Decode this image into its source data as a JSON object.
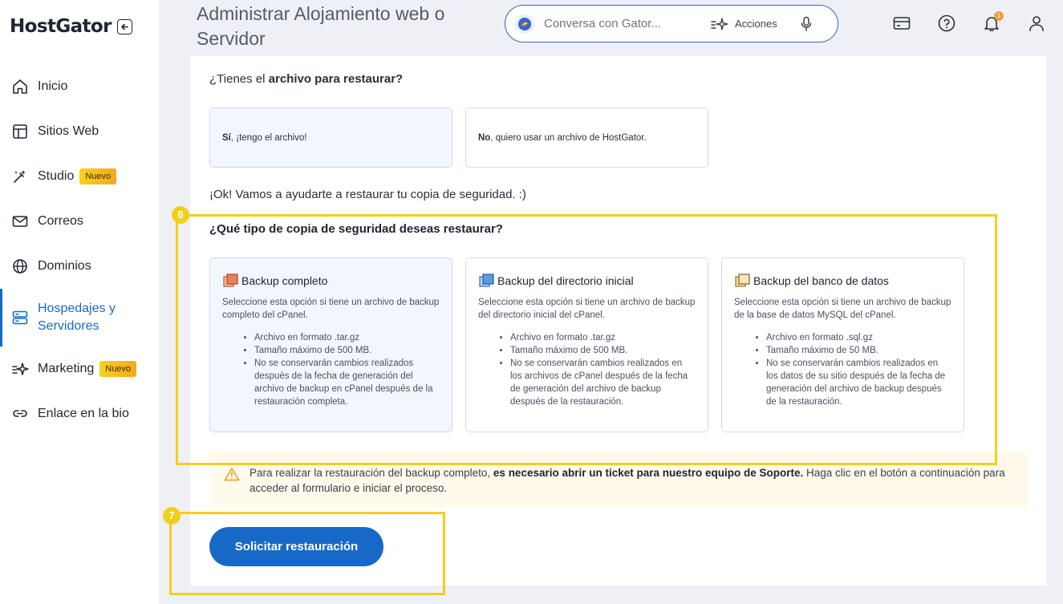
{
  "sidebar": {
    "logo": "HostGator",
    "items": [
      {
        "label": "Inicio",
        "icon": "home-icon"
      },
      {
        "label": "Sitios Web",
        "icon": "layout-icon"
      },
      {
        "label": "Studio",
        "icon": "magic-wand-icon",
        "badge": "Nuevo"
      },
      {
        "label": "Correos",
        "icon": "mail-icon"
      },
      {
        "label": "Dominios",
        "icon": "globe-icon"
      },
      {
        "label": "Hospedajes y Servidores",
        "icon": "server-icon",
        "active": true
      },
      {
        "label": "Marketing",
        "icon": "sparkle-icon",
        "badge": "Nuevo"
      },
      {
        "label": "Enlace en la bio",
        "icon": "link-icon"
      }
    ]
  },
  "header": {
    "title": "Administrar Alojamiento web o Servidor",
    "search_placeholder": "Conversa con Gator...",
    "actions_label": "Acciones",
    "notifications_count": "1"
  },
  "main": {
    "question_file_prefix": "¿Tienes el ",
    "question_file_bold": "archivo para restaurar?",
    "choices": [
      {
        "bold": "Sí",
        "rest": ", ¡tengo el archivo!",
        "selected": true
      },
      {
        "bold": "No",
        "rest": ", quiero usar un archivo de HostGator.",
        "selected": false
      }
    ],
    "ok_message": "¡Ok! Vamos a ayudarte a restaurar tu copia de seguridad. :)",
    "question_type": "¿Qué tipo de copia de seguridad deseas restaurar?",
    "backup_types": [
      {
        "title": "Backup completo",
        "description": "Seleccione esta opción si tiene un archivo de backup completo del cPanel.",
        "bullets": [
          "Archivo en formato .tar.gz",
          "Tamaño máximo de 500 MB.",
          "No se conservarán cambios realizados después de la fecha de generación del archivo de backup en cPanel después de la restauración completa."
        ],
        "selected": true
      },
      {
        "title": "Backup del directorio inicial",
        "description": "Seleccione esta opción si tiene un archivo de backup del directorio inicial del cPanel.",
        "bullets": [
          "Archivo en formato .tar.gz",
          "Tamaño máximo de 500 MB.",
          "No se conservarán cambios realizados en los archivos de cPanel después de la fecha de generación del archivo de backup después de la restauración."
        ],
        "selected": false
      },
      {
        "title": "Backup del banco de datos",
        "description": "Seleccione esta opción si tiene un archivo de backup de la base de datos MySQL del cPanel.",
        "bullets": [
          "Archivo en formato .sql.gz",
          "Tamaño máximo de 50 MB.",
          "No se conservarán cambios realizados en los datos de su sitio después de la fecha de generación del archivo de backup después de la restauración."
        ],
        "selected": false
      }
    ],
    "warning_prefix": "Para realizar la restauración del backup completo, ",
    "warning_bold": "es necesario abrir un ticket para nuestro equipo de Soporte.",
    "warning_suffix": " Haga clic en el botón a continuación para acceder al formulario e iniciar el proceso.",
    "submit_label": "Solicitar restauración"
  },
  "annotations": {
    "step_6": "6",
    "step_7": "7"
  },
  "colors": {
    "brand_blue": "#1769c7",
    "highlight_yellow": "#f2cf1d",
    "badge_orange": "#f5a623",
    "warning_bg": "#fffaeb"
  }
}
